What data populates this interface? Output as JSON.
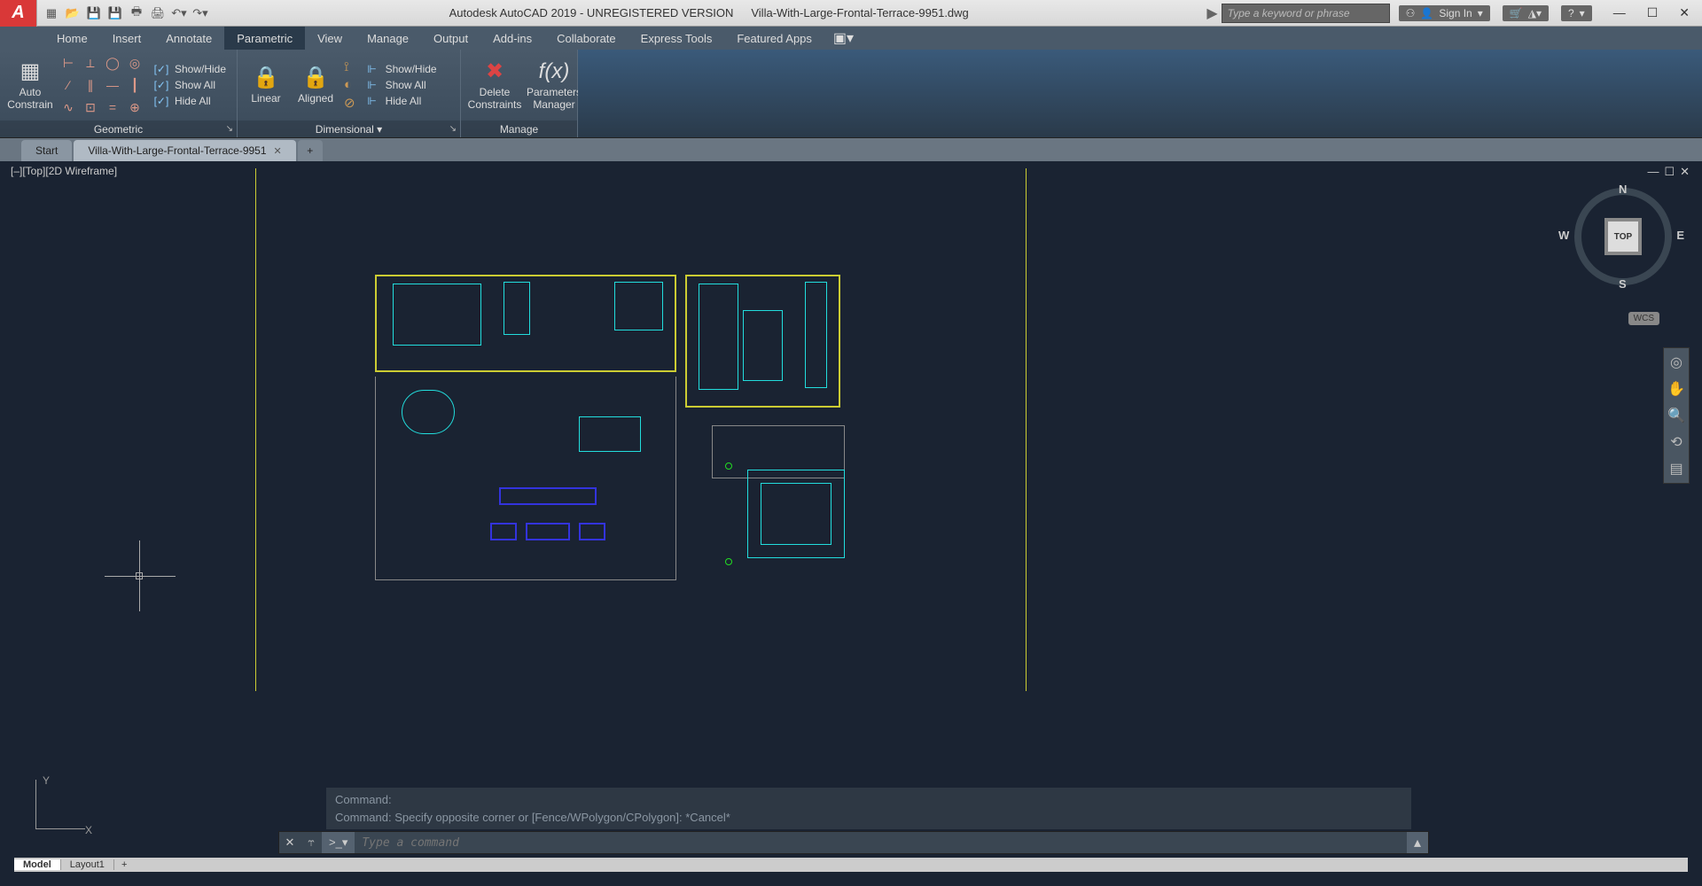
{
  "title": {
    "app": "Autodesk AutoCAD 2019 - UNREGISTERED VERSION",
    "file": "Villa-With-Large-Frontal-Terrace-9951.dwg"
  },
  "search": {
    "placeholder": "Type a keyword or phrase"
  },
  "signin": "Sign In",
  "menu": {
    "tabs": [
      "Home",
      "Insert",
      "Annotate",
      "Parametric",
      "View",
      "Manage",
      "Output",
      "Add-ins",
      "Collaborate",
      "Express Tools",
      "Featured Apps"
    ],
    "active": 3
  },
  "ribbon": {
    "geometric": {
      "title": "Geometric",
      "auto": "Auto\nConstrain",
      "sh": [
        "Show/Hide",
        "Show All",
        "Hide All"
      ]
    },
    "dimensional": {
      "title": "Dimensional ▾",
      "linear": "Linear",
      "aligned": "Aligned",
      "sh": [
        "Show/Hide",
        "Show All",
        "Hide All"
      ]
    },
    "manage": {
      "title": "Manage",
      "delete": "Delete\nConstraints",
      "params": "Parameters\nManager",
      "fx": "f(x)"
    }
  },
  "filetabs": {
    "start": "Start",
    "active": "Villa-With-Large-Frontal-Terrace-9951"
  },
  "viewport": {
    "label": "[–][Top][2D Wireframe]"
  },
  "viewcube": {
    "face": "TOP",
    "n": "N",
    "s": "S",
    "e": "E",
    "w": "W",
    "wcs": "WCS"
  },
  "ucs": {
    "x": "X",
    "y": "Y"
  },
  "cmd": {
    "hist1": "Command:",
    "hist2": "Command: Specify opposite corner or [Fence/WPolygon/CPolygon]: *Cancel*",
    "placeholder": "Type a command",
    "prompt": ">_▾"
  },
  "status": {
    "tabs": [
      "Model",
      "Layout1"
    ],
    "active": 0
  }
}
